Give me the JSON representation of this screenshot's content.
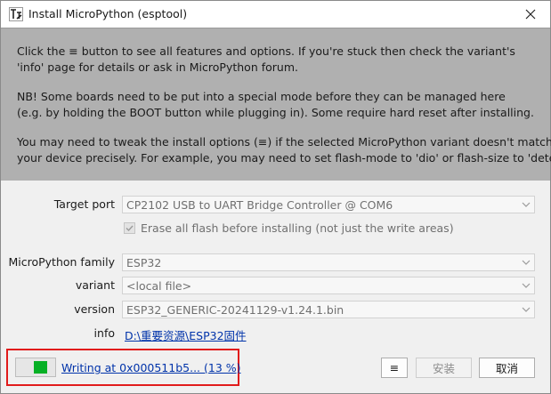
{
  "window": {
    "title": "Install MicroPython (esptool)"
  },
  "info_panel": {
    "lines": [
      "Click the ≡ button to see all features and options. If you're stuck then check the variant's",
      "'info' page for details or ask in MicroPython forum.",
      "NB! Some boards need to be put into a special mode before they can be managed here",
      "(e.g. by holding the BOOT button while plugging in). Some require hard reset after installing.",
      "You may need to tweak the install options (≡) if the selected MicroPython variant doesn't match",
      "your device precisely. For example, you may need to set flash-mode to 'dio' or flash-size to 'detect'."
    ]
  },
  "form": {
    "target_port": {
      "label": "Target port",
      "value": "CP2102 USB to UART Bridge Controller @ COM6"
    },
    "erase_flash": {
      "label": "Erase all flash before installing (not just the write areas)",
      "checked": true
    },
    "family": {
      "label": "MicroPython family",
      "value": "ESP32"
    },
    "variant": {
      "label": "variant",
      "value": "<local file>"
    },
    "version": {
      "label": "version",
      "value": "ESP32_GENERIC-20241129-v1.24.1.bin"
    },
    "info": {
      "label": "info",
      "link_text": "D:\\重要资源\\ESP32固件"
    }
  },
  "progress": {
    "text": "Writing at 0x000511b5... (13 %)",
    "percent": 13,
    "color": "#06b025",
    "highlight_color": "#e11b1b"
  },
  "buttons": {
    "menu": "≡",
    "install": "安装",
    "cancel": "取消"
  },
  "icons": {
    "app": "thonny-icon",
    "close": "close-icon",
    "dropdown": "chevron-down-icon",
    "check": "check-icon"
  }
}
